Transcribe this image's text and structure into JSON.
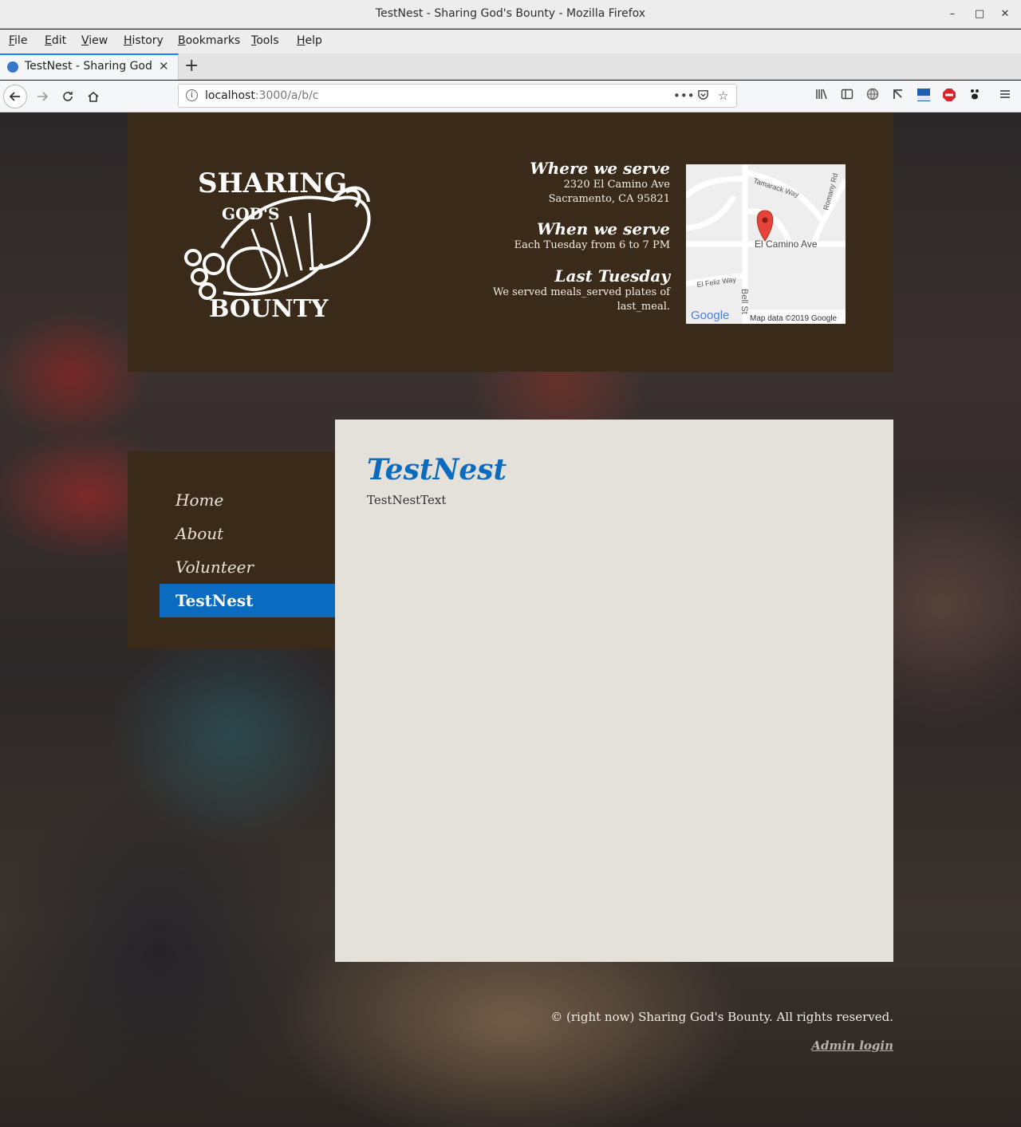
{
  "window": {
    "title": "TestNest - Sharing God's Bounty - Mozilla Firefox",
    "minimize_glyph": "–",
    "maximize_glyph": "□",
    "close_glyph": "✕"
  },
  "menu": [
    "File",
    "Edit",
    "View",
    "History",
    "Bookmarks",
    "Tools",
    "Help"
  ],
  "tab": {
    "title": "TestNest - Sharing God's Bounty",
    "close_glyph": "✕",
    "new_glyph": "+"
  },
  "urlbar": {
    "host": "localhost",
    "rest": ":3000/a/b/c"
  },
  "site": {
    "logo": {
      "line1": "SHARING",
      "line2": "GOD'S",
      "line3": "BOUNTY"
    },
    "where": {
      "heading": "Where we serve",
      "line1": "2320 El Camino Ave",
      "line2": "Sacramento, CA 95821"
    },
    "when": {
      "heading": "When we serve",
      "line1": "Each Tuesday from 6 to 7 PM"
    },
    "last": {
      "heading": "Last Tuesday",
      "line1": "We served meals_served plates of",
      "line2": "last_meal."
    },
    "map": {
      "labels": {
        "tamarack": "Tamarack Way",
        "romany": "Romany Rd",
        "camino": "El Camino Ave",
        "feliz": "El Feliz Way",
        "bell": "Bell St"
      },
      "google": "Google",
      "attribution": "Map data ©2019 Google"
    },
    "nav": [
      "Home",
      "About",
      "Volunteer",
      "TestNest"
    ],
    "active_nav": "TestNest",
    "content": {
      "title": "TestNest",
      "text": "TestNestText"
    },
    "footer": {
      "copyright": "© (right now) Sharing God's Bounty. All rights reserved.",
      "admin": "Admin login"
    }
  },
  "colors": {
    "brown": "#3a2a19",
    "accent": "#0a6bbf",
    "content_bg": "#e4e1db"
  }
}
